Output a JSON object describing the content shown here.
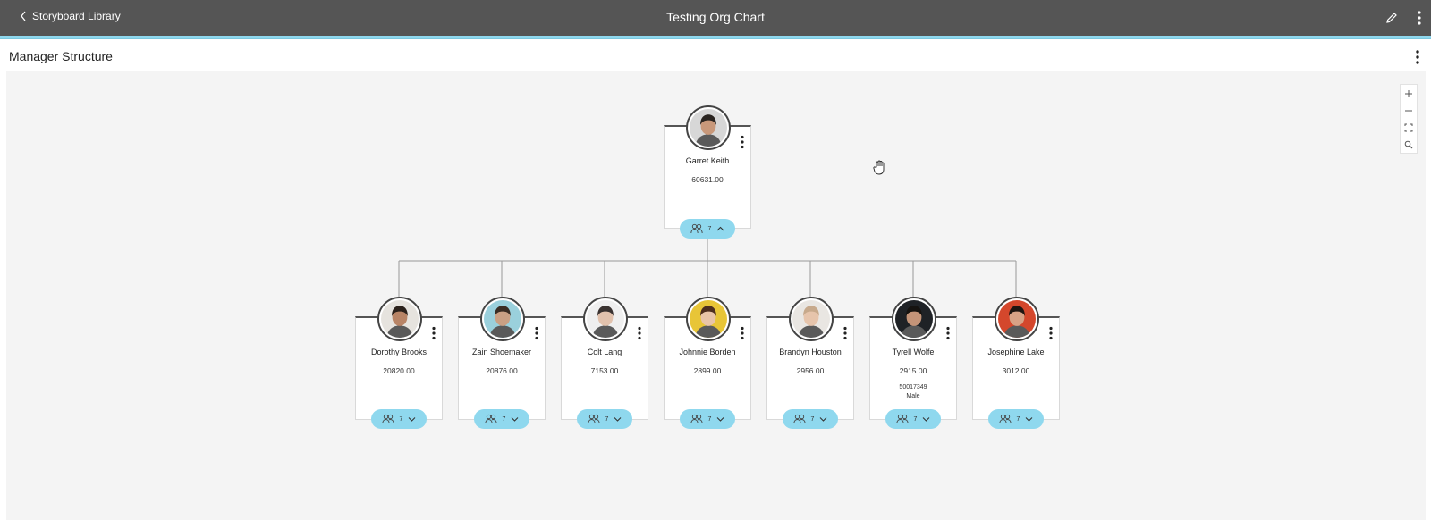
{
  "header": {
    "back_label": "Storyboard Library",
    "title": "Testing Org Chart"
  },
  "section": {
    "title": "Manager Structure"
  },
  "zoom_controls": [
    "zoom-in",
    "zoom-out",
    "fit-screen",
    "search"
  ],
  "org": {
    "root": {
      "name": "Garret Keith",
      "value": "60631.00",
      "reports_count": "7",
      "expanded": true,
      "avatar_colors": {
        "bg": "#d7d7d7",
        "skin": "#c8987a",
        "hair": "#2a2420"
      }
    },
    "children": [
      {
        "name": "Dorothy Brooks",
        "value": "20820.00",
        "reports_count": "7",
        "avatar_colors": {
          "bg": "#e6e3de",
          "skin": "#b88466",
          "hair": "#2b211b"
        }
      },
      {
        "name": "Zain Shoemaker",
        "value": "20876.00",
        "reports_count": "7",
        "avatar_colors": {
          "bg": "#9ad0dc",
          "skin": "#caa084",
          "hair": "#3a2d24"
        }
      },
      {
        "name": "Colt Lang",
        "value": "7153.00",
        "reports_count": "7",
        "avatar_colors": {
          "bg": "#efefef",
          "skin": "#e2c2ad",
          "hair": "#3a3230"
        }
      },
      {
        "name": "Johnnie Borden",
        "value": "2899.00",
        "reports_count": "7",
        "avatar_colors": {
          "bg": "#e8c537",
          "skin": "#e8c4a8",
          "hair": "#4d2e1e"
        }
      },
      {
        "name": "Brandyn Houston",
        "value": "2956.00",
        "reports_count": "7",
        "avatar_colors": {
          "bg": "#e9e6e2",
          "skin": "#e6c4ab",
          "hair": "#c7a98b"
        }
      },
      {
        "name": "Tyrell Wolfe",
        "value": "2915.00",
        "extra_1": "50017349",
        "extra_2": "Male",
        "reports_count": "7",
        "avatar_colors": {
          "bg": "#1f2226",
          "skin": "#c49478",
          "hair": "#161310"
        }
      },
      {
        "name": "Josephine Lake",
        "value": "3012.00",
        "reports_count": "7",
        "avatar_colors": {
          "bg": "#d4472c",
          "skin": "#d8a286",
          "hair": "#1f1511"
        }
      }
    ]
  },
  "colors": {
    "topbar": "#555555",
    "accent": "#8fd8ee",
    "pill": "#8fd8ee",
    "canvas": "#f4f4f4"
  }
}
